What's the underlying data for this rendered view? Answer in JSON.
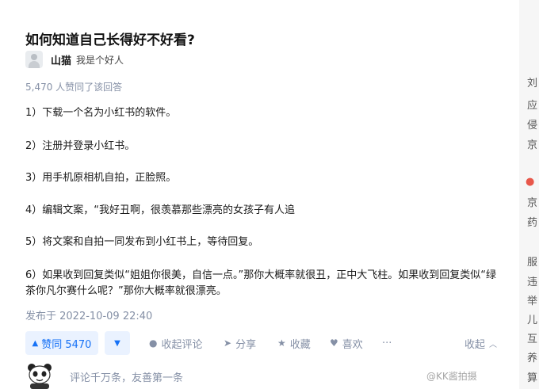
{
  "question": {
    "title": "如何知道自己长得好不好看?"
  },
  "author": {
    "name": "山猫",
    "bio": "我是个好人"
  },
  "vote_summary": "5,470 人赞同了该回答",
  "paragraphs": [
    "1）下载一个名为小红书的软件。",
    "2）注册并登录小红书。",
    "3）用手机原相机自拍，正脸照。",
    "4）编辑文案，“我好丑啊，很羡慕那些漂亮的女孩子有人追",
    "5）将文案和自拍一同发布到小红书上，等待回复。",
    "6）如果收到回复类似“姐姐你很美，自信一点。”那你大概率就很丑，正中大飞柱。如果收到回复类似“绿茶你凡尔赛什么呢？”那你大概率就很漂亮。"
  ],
  "published": "发布于 2022-10-09 22:40",
  "actions": {
    "vote_label": "赞同 5470",
    "comment_label": "收起评论",
    "share_label": "分享",
    "favorite_label": "收藏",
    "like_label": "喜欢",
    "more_label": "···",
    "collapse_label": "收起"
  },
  "comment": {
    "placeholder": "评论千万条，友善第一条"
  },
  "sidebar_peek": [
    "刘",
    "应",
    "侵",
    "京",
    "京",
    "药",
    "服",
    "违",
    "举",
    "儿",
    "互",
    "养",
    "算"
  ],
  "watermark": "@KK酱拍摄",
  "colors": {
    "accent": "#1772f6",
    "vote_bg": "#eaf2ff",
    "meta": "#8590a6"
  }
}
